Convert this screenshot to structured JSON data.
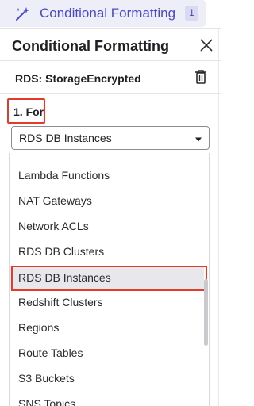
{
  "tab": {
    "label": "Conditional Formatting",
    "badge": "1",
    "icon": "magic-wand-icon",
    "accent": "#4b49c9"
  },
  "panel": {
    "title": "Conditional Formatting",
    "close_icon": "close-icon"
  },
  "rule": {
    "name": "RDS: StorageEncrypted",
    "delete_icon": "trash-icon"
  },
  "section": {
    "label": "1. For"
  },
  "select": {
    "value": "RDS DB Instances",
    "caret_icon": "caret-down-icon"
  },
  "dropdown": {
    "options": [
      "Lambda Functions",
      "NAT Gateways",
      "Network ACLs",
      "RDS DB Clusters",
      "RDS DB Instances",
      "Redshift Clusters",
      "Regions",
      "Route Tables",
      "S3 Buckets",
      "SNS Topics"
    ],
    "selected_index": 4
  },
  "colors": {
    "highlight_red": "#e23b2a",
    "selected_bg": "#e8e8ec"
  }
}
